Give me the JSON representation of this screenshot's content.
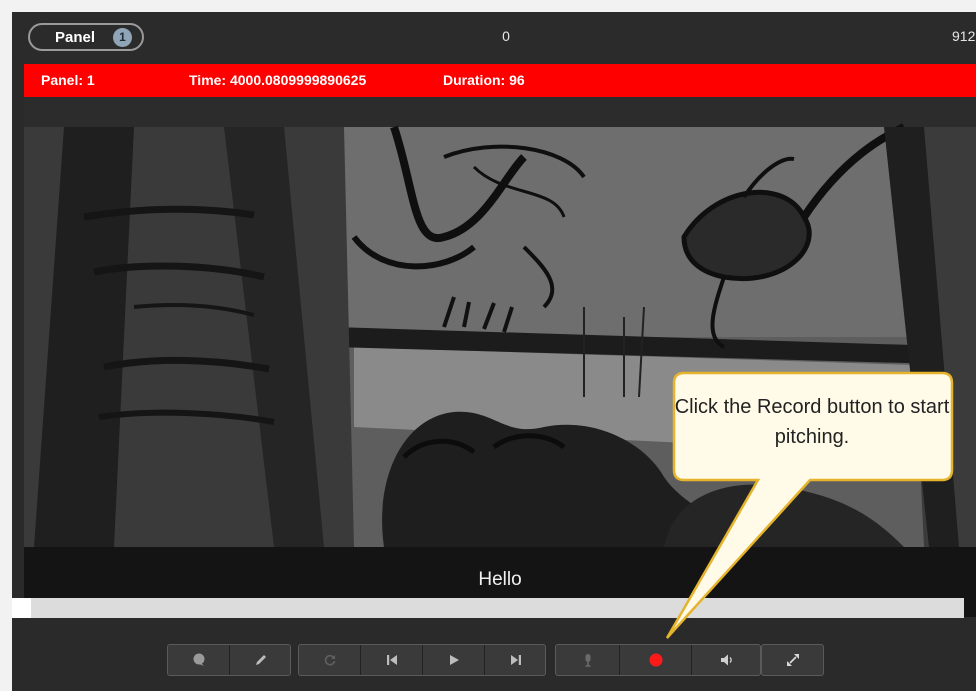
{
  "topbar": {
    "panel_label": "Panel",
    "panel_badge": "1",
    "counter": "0",
    "end_count": "912"
  },
  "infobar": {
    "panel": "Panel: 1",
    "time": "Time: 4000.0809999890625",
    "duration": "Duration: 96",
    "color": "#ff0000"
  },
  "viewport": {
    "subtitle": "Hello"
  },
  "progress": {
    "fraction": 0.02
  },
  "controls": {
    "groups": [
      [
        "comment-icon",
        "pencil-icon"
      ],
      [
        "loop-icon",
        "skip-back-icon",
        "play-icon",
        "skip-forward-icon"
      ],
      [
        "microphone-icon",
        "record-icon",
        "volume-icon"
      ],
      [
        "fullscreen-icon"
      ]
    ],
    "record_color": "#ff1a1a"
  },
  "callout": {
    "text": "Click the Record button to start pitching.",
    "background": "#fffbe8",
    "border": "#e5b32c"
  }
}
